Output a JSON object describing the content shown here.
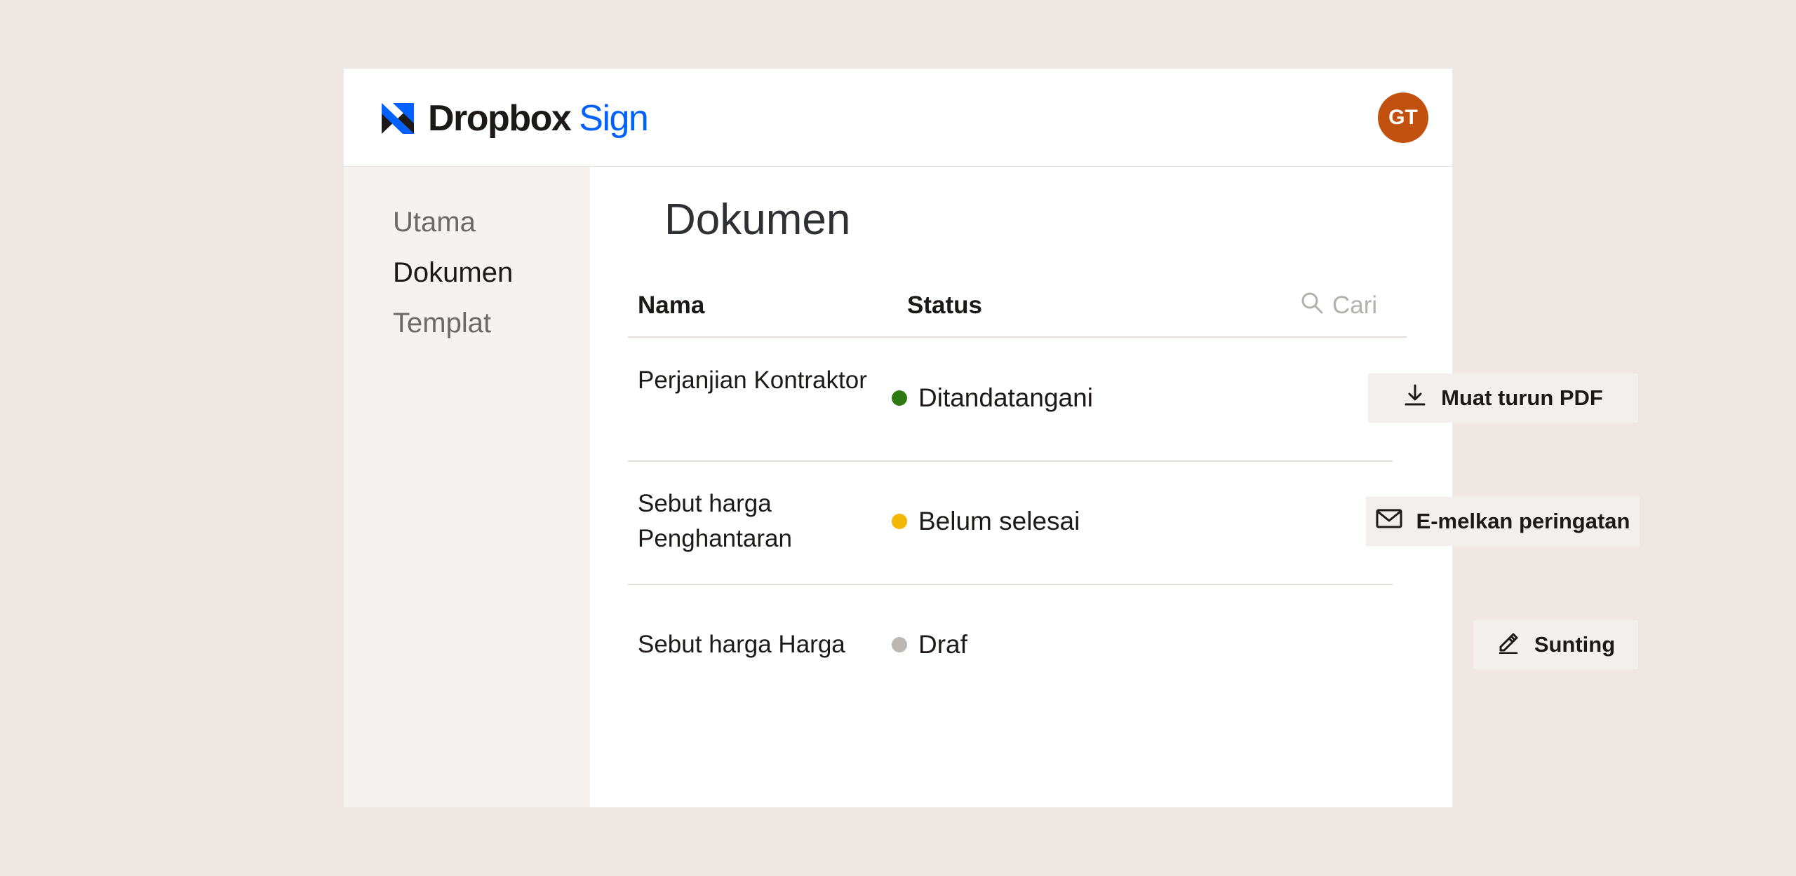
{
  "header": {
    "brand_name": "Dropbox",
    "brand_product": "Sign",
    "brand_color": "#0061FE",
    "logo_icon": "dropbox-sign-logo-icon",
    "avatar": {
      "initials": "GT",
      "color": "#C2510F"
    }
  },
  "sidebar": {
    "items": [
      {
        "label": "Utama",
        "active": false
      },
      {
        "label": "Dokumen",
        "active": true
      },
      {
        "label": "Templat",
        "active": false
      }
    ]
  },
  "main": {
    "title": "Dokumen",
    "columns": {
      "name": "Nama",
      "status": "Status"
    },
    "search": {
      "placeholder": "Cari",
      "icon": "search-icon"
    },
    "rows": [
      {
        "name": "Perjanjian Kontraktor",
        "status": "Ditandatangani",
        "status_color": "#2D7A13",
        "action": {
          "label": "Muat turun PDF",
          "icon": "download-icon"
        }
      },
      {
        "name": "Sebut harga Penghantaran",
        "status": "Belum selesai",
        "status_color": "#F2B705",
        "action": {
          "label": "E-melkan peringatan",
          "icon": "envelope-icon"
        }
      },
      {
        "name": "Sebut harga Harga",
        "status": "Draf",
        "status_color": "#BBB8B3",
        "action": {
          "label": "Sunting",
          "icon": "pencil-icon"
        }
      }
    ]
  }
}
